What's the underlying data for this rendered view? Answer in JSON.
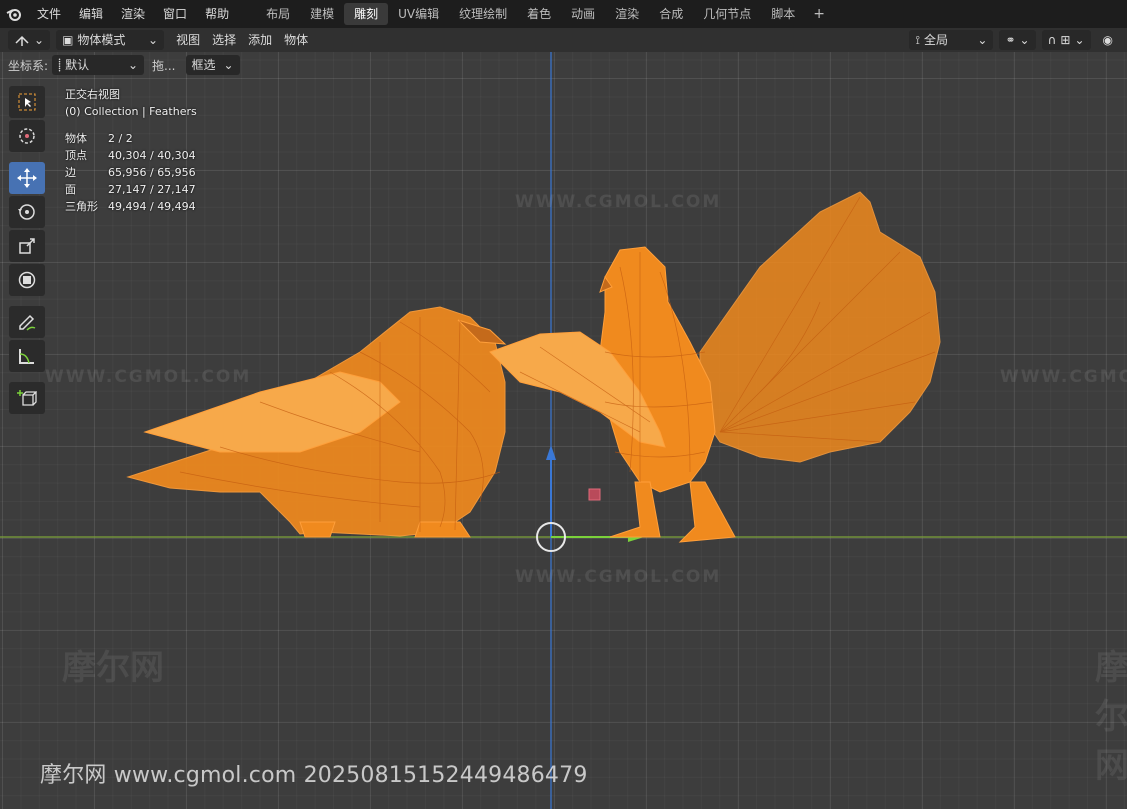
{
  "menu": {
    "file": "文件",
    "edit": "编辑",
    "render": "渲染",
    "window": "窗口",
    "help": "帮助"
  },
  "tabs": [
    "布局",
    "建模",
    "雕刻",
    "UV编辑",
    "纹理绘制",
    "着色",
    "动画",
    "渲染",
    "合成",
    "几何节点",
    "脚本"
  ],
  "active_tab": "雕刻",
  "header": {
    "mode": "物体模式",
    "view": "视图",
    "select": "选择",
    "add": "添加",
    "object": "物体",
    "transform_orientation": "全局"
  },
  "subheader": {
    "coord_label": "坐标系:",
    "coord_value": "默认",
    "drag_label": "拖...",
    "select_mode": "框选"
  },
  "overlay": {
    "view_name": "正交右视图",
    "collection": "(0) Collection | Feathers",
    "stats": [
      {
        "label": "物体",
        "value": "2 / 2"
      },
      {
        "label": "顶点",
        "value": "40,304 / 40,304"
      },
      {
        "label": "边",
        "value": "65,956 / 65,956"
      },
      {
        "label": "面",
        "value": "27,147 / 27,147"
      },
      {
        "label": "三角形",
        "value": "49,494 / 49,494"
      }
    ]
  },
  "watermarks": {
    "site_en": "WWW.CGMOL.COM",
    "site_cn": "摩尔网",
    "footer": "摩尔网 www.cgmol.com 20250815152449486479"
  },
  "colors": {
    "accent": "#4772b3",
    "model": "#f08a1e",
    "axis_green": "#7da23a",
    "axis_blue": "#3a78d6"
  }
}
